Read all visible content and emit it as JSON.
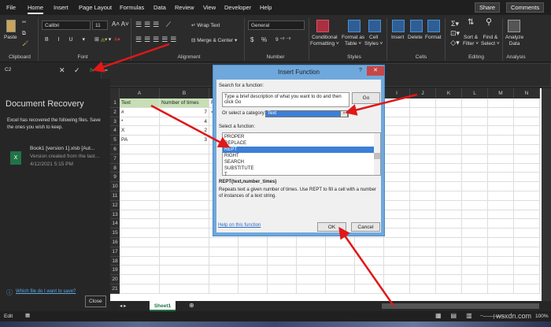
{
  "ribbon_tabs": [
    "File",
    "Home",
    "Insert",
    "Page Layout",
    "Formulas",
    "Data",
    "Review",
    "View",
    "Developer",
    "Help"
  ],
  "active_tab": "Home",
  "share": "Share",
  "comments": "Comments",
  "clipboard": {
    "paste": "Paste",
    "group": "Clipboard"
  },
  "font": {
    "name": "Calibri",
    "size": "11",
    "group": "Font"
  },
  "alignment": {
    "wrap": "Wrap Text",
    "merge": "Merge & Center",
    "group": "Alignment"
  },
  "number": {
    "format": "General",
    "group": "Number",
    "currency": "$",
    "percent": "%"
  },
  "styles": {
    "cond": [
      "Conditional",
      "Formatting ˅"
    ],
    "table": [
      "Format as",
      "Table ˅"
    ],
    "cell": [
      "Cell",
      "Styles ˅"
    ],
    "group": "Styles"
  },
  "cells": {
    "insert": "Insert",
    "delete": "Delete",
    "format": "Format",
    "group": "Cells"
  },
  "editing": {
    "sort": [
      "Sort &",
      "Filter ˅"
    ],
    "find": [
      "Find &",
      "Select ˅"
    ],
    "group": "Editing"
  },
  "analysis": {
    "analyze": [
      "Analyze",
      "Data"
    ],
    "group": "Analysis"
  },
  "formula_bar": {
    "name_box": "C2",
    "fx": "fx",
    "content": "="
  },
  "recovery": {
    "title": "Document Recovery",
    "desc": "Excel has recovered the following files.  Save the ones you wish to keep.",
    "file_name": "Book1 [version 1].xlsb  [Aut...",
    "file_desc": "Version created from the last...",
    "file_time": "4/12/2021 5:15 PM",
    "help_link": "Which file do I want to save?",
    "close": "Close"
  },
  "columns": [
    "A",
    "B",
    "C",
    "D",
    "E",
    "F",
    "G",
    "H",
    "I",
    "J",
    "K",
    "L",
    "M",
    "N"
  ],
  "rows": [
    "1",
    "2",
    "3",
    "4",
    "5",
    "6",
    "7",
    "8",
    "9",
    "10",
    "11",
    "12",
    "13",
    "14",
    "15",
    "16",
    "17",
    "18",
    "19",
    "20",
    "21"
  ],
  "cells_data": [
    [
      "Text",
      "Number of times",
      "R"
    ],
    [
      "#",
      "7",
      "="
    ],
    [
      "*",
      "4",
      ""
    ],
    [
      "X",
      "2",
      ""
    ],
    [
      "PA",
      "3",
      ""
    ]
  ],
  "sheet_tab": "Sheet1",
  "dialog": {
    "title": "Insert Function",
    "help": "?",
    "close": "✕",
    "search_label": "Search for a function:",
    "search_text": "Type a brief description of what you want to do and then click Go",
    "go": "Go",
    "category_label": "Or select a category:",
    "category": "Text",
    "select_label": "Select a function:",
    "functions": [
      "PROPER",
      "REPLACE",
      "REPT",
      "RIGHT",
      "SEARCH",
      "SUBSTITUTE",
      "T"
    ],
    "selected": "REPT",
    "signature": "REPT(text,number_times)",
    "description": "Repeats text a given number of times. Use REPT to fill a cell with a number of instances of a text string.",
    "help_link": "Help on this function",
    "ok": "OK",
    "cancel": "Cancel"
  },
  "status": {
    "mode": "Edit",
    "zoom": "100%"
  },
  "watermark": "wsxdn.com",
  "accent": "#217346"
}
